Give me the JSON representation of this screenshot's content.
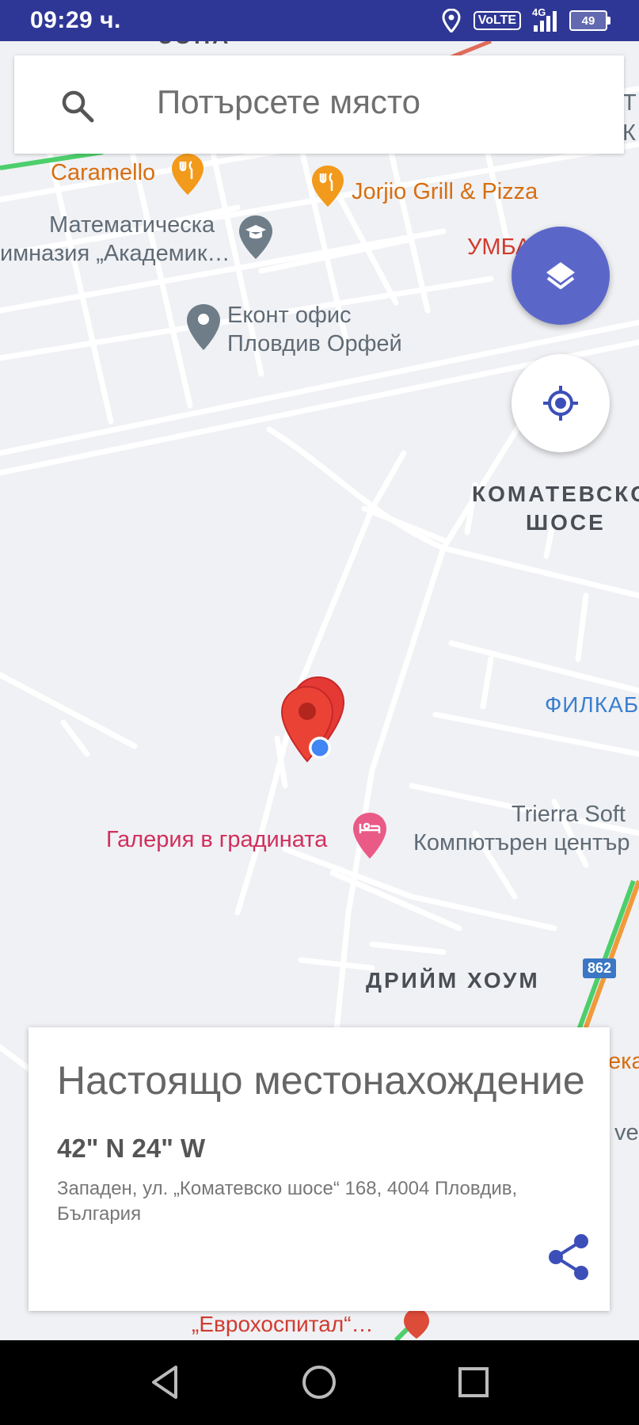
{
  "status_bar": {
    "time": "09:29 ч.",
    "volte": "VoLTE",
    "network": "4G",
    "battery": "49"
  },
  "search": {
    "placeholder": "Потърсете място"
  },
  "map": {
    "top_partial_label": "ЗОНА",
    "pois": {
      "caramello": "Caramello",
      "jorjio": "Jorjio Grill & Pizza",
      "school_line1": "Математическа",
      "school_line2": "имназия „Академик…",
      "umbal": "УМБАЛ Спе",
      "econt_line1": "Еконт офис",
      "econt_line2": "Пловдив Орфей",
      "komatevsko_line1": "КОМАТЕВСКО",
      "komatevsko_line2": "ШОСЕ",
      "filkab": "ФИЛКАБ",
      "trierra_line1": "Trierra Soft",
      "trierra_line2": "Компютърен център",
      "gallery": "Галерия в градината",
      "dream_home": "ДРИЙМ ХОУМ",
      "road_number": "862",
      "eurohospital": "„Еврохоспитал“…",
      "right_edge_1": "ека",
      "right_edge_2": "ver",
      "top_right_1": "Т",
      "top_right_2": "К"
    }
  },
  "card": {
    "title": "Настоящо местонахождение",
    "coordinates": "42\" N 24\" W",
    "address": "Западен, ул. „Коматевско шосе“ 168, 4004 Пловдив, България"
  },
  "colors": {
    "status_bar": "#2f3796",
    "fab_layers": "#5b67c8",
    "accent": "#3c4fb8",
    "pin": "#e53935"
  }
}
